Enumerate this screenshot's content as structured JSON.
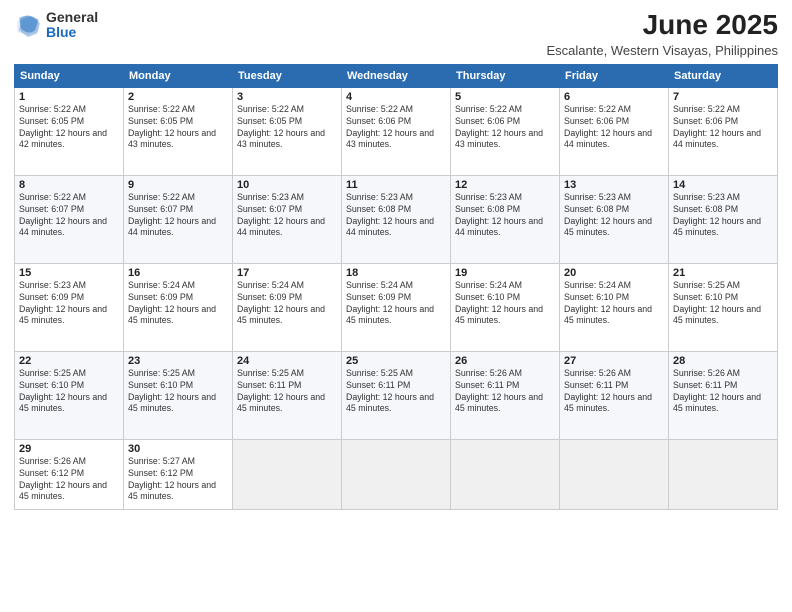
{
  "header": {
    "logo_general": "General",
    "logo_blue": "Blue",
    "month_title": "June 2025",
    "location": "Escalante, Western Visayas, Philippines"
  },
  "days_of_week": [
    "Sunday",
    "Monday",
    "Tuesday",
    "Wednesday",
    "Thursday",
    "Friday",
    "Saturday"
  ],
  "weeks": [
    [
      {
        "day": "1",
        "sunrise": "5:22 AM",
        "sunset": "6:05 PM",
        "daylight": "12 hours and 42 minutes."
      },
      {
        "day": "2",
        "sunrise": "5:22 AM",
        "sunset": "6:05 PM",
        "daylight": "12 hours and 43 minutes."
      },
      {
        "day": "3",
        "sunrise": "5:22 AM",
        "sunset": "6:05 PM",
        "daylight": "12 hours and 43 minutes."
      },
      {
        "day": "4",
        "sunrise": "5:22 AM",
        "sunset": "6:06 PM",
        "daylight": "12 hours and 43 minutes."
      },
      {
        "day": "5",
        "sunrise": "5:22 AM",
        "sunset": "6:06 PM",
        "daylight": "12 hours and 43 minutes."
      },
      {
        "day": "6",
        "sunrise": "5:22 AM",
        "sunset": "6:06 PM",
        "daylight": "12 hours and 44 minutes."
      },
      {
        "day": "7",
        "sunrise": "5:22 AM",
        "sunset": "6:06 PM",
        "daylight": "12 hours and 44 minutes."
      }
    ],
    [
      {
        "day": "8",
        "sunrise": "5:22 AM",
        "sunset": "6:07 PM",
        "daylight": "12 hours and 44 minutes."
      },
      {
        "day": "9",
        "sunrise": "5:22 AM",
        "sunset": "6:07 PM",
        "daylight": "12 hours and 44 minutes."
      },
      {
        "day": "10",
        "sunrise": "5:23 AM",
        "sunset": "6:07 PM",
        "daylight": "12 hours and 44 minutes."
      },
      {
        "day": "11",
        "sunrise": "5:23 AM",
        "sunset": "6:08 PM",
        "daylight": "12 hours and 44 minutes."
      },
      {
        "day": "12",
        "sunrise": "5:23 AM",
        "sunset": "6:08 PM",
        "daylight": "12 hours and 44 minutes."
      },
      {
        "day": "13",
        "sunrise": "5:23 AM",
        "sunset": "6:08 PM",
        "daylight": "12 hours and 45 minutes."
      },
      {
        "day": "14",
        "sunrise": "5:23 AM",
        "sunset": "6:08 PM",
        "daylight": "12 hours and 45 minutes."
      }
    ],
    [
      {
        "day": "15",
        "sunrise": "5:23 AM",
        "sunset": "6:09 PM",
        "daylight": "12 hours and 45 minutes."
      },
      {
        "day": "16",
        "sunrise": "5:24 AM",
        "sunset": "6:09 PM",
        "daylight": "12 hours and 45 minutes."
      },
      {
        "day": "17",
        "sunrise": "5:24 AM",
        "sunset": "6:09 PM",
        "daylight": "12 hours and 45 minutes."
      },
      {
        "day": "18",
        "sunrise": "5:24 AM",
        "sunset": "6:09 PM",
        "daylight": "12 hours and 45 minutes."
      },
      {
        "day": "19",
        "sunrise": "5:24 AM",
        "sunset": "6:10 PM",
        "daylight": "12 hours and 45 minutes."
      },
      {
        "day": "20",
        "sunrise": "5:24 AM",
        "sunset": "6:10 PM",
        "daylight": "12 hours and 45 minutes."
      },
      {
        "day": "21",
        "sunrise": "5:25 AM",
        "sunset": "6:10 PM",
        "daylight": "12 hours and 45 minutes."
      }
    ],
    [
      {
        "day": "22",
        "sunrise": "5:25 AM",
        "sunset": "6:10 PM",
        "daylight": "12 hours and 45 minutes."
      },
      {
        "day": "23",
        "sunrise": "5:25 AM",
        "sunset": "6:10 PM",
        "daylight": "12 hours and 45 minutes."
      },
      {
        "day": "24",
        "sunrise": "5:25 AM",
        "sunset": "6:11 PM",
        "daylight": "12 hours and 45 minutes."
      },
      {
        "day": "25",
        "sunrise": "5:25 AM",
        "sunset": "6:11 PM",
        "daylight": "12 hours and 45 minutes."
      },
      {
        "day": "26",
        "sunrise": "5:26 AM",
        "sunset": "6:11 PM",
        "daylight": "12 hours and 45 minutes."
      },
      {
        "day": "27",
        "sunrise": "5:26 AM",
        "sunset": "6:11 PM",
        "daylight": "12 hours and 45 minutes."
      },
      {
        "day": "28",
        "sunrise": "5:26 AM",
        "sunset": "6:11 PM",
        "daylight": "12 hours and 45 minutes."
      }
    ],
    [
      {
        "day": "29",
        "sunrise": "5:26 AM",
        "sunset": "6:12 PM",
        "daylight": "12 hours and 45 minutes."
      },
      {
        "day": "30",
        "sunrise": "5:27 AM",
        "sunset": "6:12 PM",
        "daylight": "12 hours and 45 minutes."
      },
      null,
      null,
      null,
      null,
      null
    ]
  ]
}
